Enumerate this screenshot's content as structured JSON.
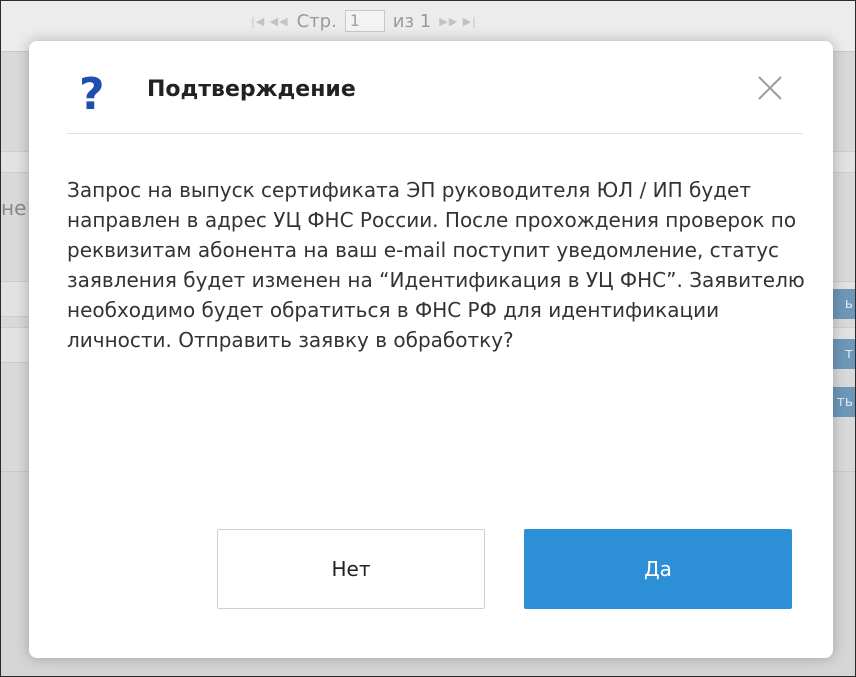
{
  "background": {
    "pager": {
      "prefix": "Стр.",
      "page_value": "1",
      "of_label": "из 1"
    },
    "left_fragment": "не",
    "right_buttons": [
      "ь",
      "т",
      "ть"
    ]
  },
  "dialog": {
    "icon": "question-icon",
    "title": "Подтверждение",
    "close_icon": "close-icon",
    "message": "Запрос на выпуск сертификата ЭП руководителя ЮЛ / ИП будет направлен в адрес УЦ ФНС России. После прохождения проверок по реквизитам абонента на ваш e-mail поступит уведомление, статус заявления будет изменен на “Идентификация в УЦ ФНС”. Заявителю необходимо будет обратиться в ФНС РФ для идентификации личности. Отправить заявку в обработку?",
    "buttons": {
      "no_label": "Нет",
      "yes_label": "Да"
    }
  },
  "colors": {
    "accent": "#2d8fd5",
    "icon": "#1e4fb0"
  }
}
